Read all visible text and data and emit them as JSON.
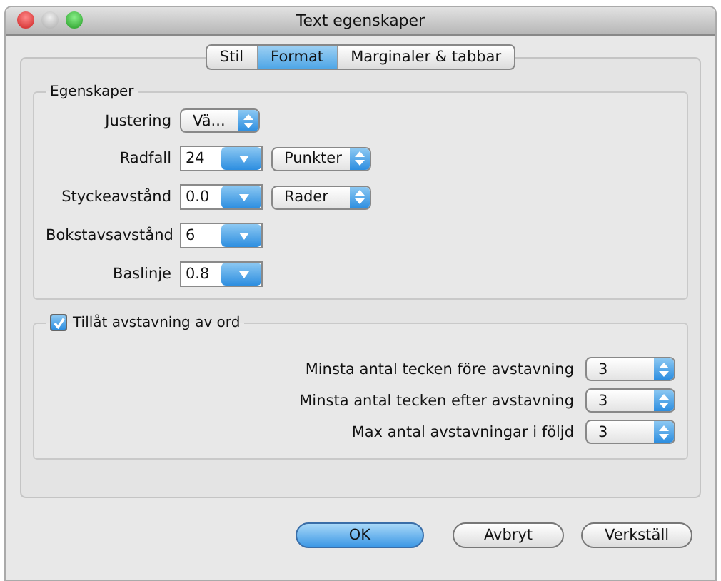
{
  "window": {
    "title": "Text egenskaper"
  },
  "tabs": [
    {
      "label": "Stil",
      "selected": false
    },
    {
      "label": "Format",
      "selected": true
    },
    {
      "label": "Marginaler & tabbar",
      "selected": false
    }
  ],
  "properties": {
    "title": "Egenskaper",
    "rows": [
      {
        "label": "Justering",
        "kind": "popup",
        "value": "Vä..."
      },
      {
        "label": "Radfall",
        "kind": "combo",
        "value": "24",
        "unit": "Punkter"
      },
      {
        "label": "Styckeavstånd",
        "kind": "combo",
        "value": "0.0",
        "unit": "Rader"
      },
      {
        "label": "Bokstavsavstånd",
        "kind": "combo",
        "value": "6"
      },
      {
        "label": "Baslinje",
        "kind": "combo",
        "value": "0.8"
      }
    ]
  },
  "hyphenation": {
    "label": "Tillåt avstavning av ord",
    "checked": true,
    "rows": [
      {
        "label": "Minsta antal tecken före avstavning",
        "value": "3"
      },
      {
        "label": "Minsta antal tecken efter avstavning",
        "value": "3"
      },
      {
        "label": "Max antal avstavningar i följd",
        "value": "3"
      }
    ]
  },
  "buttons": [
    {
      "label": "OK",
      "default": true
    },
    {
      "label": "Avbryt",
      "default": false
    },
    {
      "label": "Verkställ",
      "default": false
    }
  ]
}
